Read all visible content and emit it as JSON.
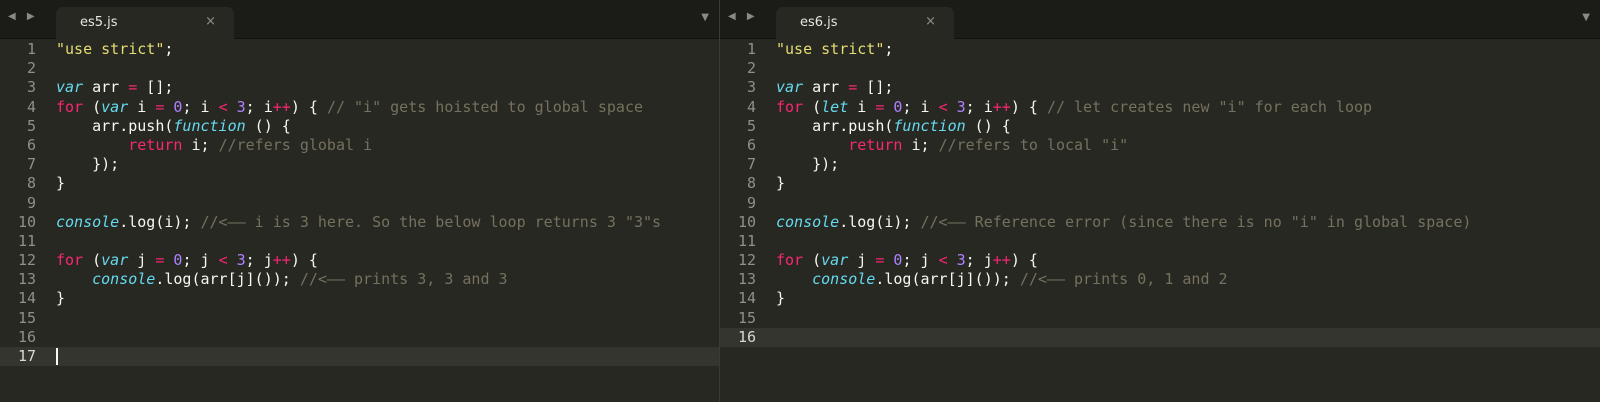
{
  "left": {
    "tab": {
      "label": "es5.js",
      "close": "×"
    },
    "nav": "◀ ▶",
    "dropdown": "▼",
    "lines": [
      {
        "n": "1",
        "tokens": [
          [
            "str",
            "\"use strict\""
          ],
          [
            "pl",
            ";"
          ]
        ]
      },
      {
        "n": "2",
        "tokens": []
      },
      {
        "n": "3",
        "tokens": [
          [
            "st",
            "var"
          ],
          [
            "pl",
            " arr "
          ],
          [
            "op",
            "="
          ],
          [
            "pl",
            " [];"
          ]
        ]
      },
      {
        "n": "4",
        "tokens": [
          [
            "kw",
            "for"
          ],
          [
            "pl",
            " ("
          ],
          [
            "st",
            "var"
          ],
          [
            "pl",
            " i "
          ],
          [
            "op",
            "="
          ],
          [
            "pl",
            " "
          ],
          [
            "num",
            "0"
          ],
          [
            "pl",
            "; i "
          ],
          [
            "op",
            "<"
          ],
          [
            "pl",
            " "
          ],
          [
            "num",
            "3"
          ],
          [
            "pl",
            "; i"
          ],
          [
            "op",
            "++"
          ],
          [
            "pl",
            ") { "
          ],
          [
            "cm",
            "// \"i\" gets hoisted to global space"
          ]
        ]
      },
      {
        "n": "5",
        "tokens": [
          [
            "pl",
            "    arr"
          ],
          [
            "pl",
            "."
          ],
          [
            "fn",
            "push"
          ],
          [
            "pl",
            "("
          ],
          [
            "st",
            "function"
          ],
          [
            "pl",
            " () {"
          ]
        ]
      },
      {
        "n": "6",
        "tokens": [
          [
            "pl",
            "        "
          ],
          [
            "kw",
            "return"
          ],
          [
            "pl",
            " i; "
          ],
          [
            "cm",
            "//refers global i"
          ]
        ]
      },
      {
        "n": "7",
        "tokens": [
          [
            "pl",
            "    });"
          ]
        ]
      },
      {
        "n": "8",
        "tokens": [
          [
            "pl",
            "}"
          ]
        ]
      },
      {
        "n": "9",
        "tokens": []
      },
      {
        "n": "10",
        "tokens": [
          [
            "st",
            "console"
          ],
          [
            "pl",
            "."
          ],
          [
            "fn",
            "log"
          ],
          [
            "pl",
            "(i); "
          ],
          [
            "cm",
            "//<—— i is 3 here. So the below loop returns 3 \"3\"s"
          ]
        ]
      },
      {
        "n": "11",
        "tokens": []
      },
      {
        "n": "12",
        "tokens": [
          [
            "kw",
            "for"
          ],
          [
            "pl",
            " ("
          ],
          [
            "st",
            "var"
          ],
          [
            "pl",
            " j "
          ],
          [
            "op",
            "="
          ],
          [
            "pl",
            " "
          ],
          [
            "num",
            "0"
          ],
          [
            "pl",
            "; j "
          ],
          [
            "op",
            "<"
          ],
          [
            "pl",
            " "
          ],
          [
            "num",
            "3"
          ],
          [
            "pl",
            "; j"
          ],
          [
            "op",
            "++"
          ],
          [
            "pl",
            ") {"
          ]
        ]
      },
      {
        "n": "13",
        "tokens": [
          [
            "pl",
            "    "
          ],
          [
            "st",
            "console"
          ],
          [
            "pl",
            "."
          ],
          [
            "fn",
            "log"
          ],
          [
            "pl",
            "(arr[j]()); "
          ],
          [
            "cm",
            "//<—— prints 3, 3 and 3"
          ]
        ]
      },
      {
        "n": "14",
        "tokens": [
          [
            "pl",
            "}"
          ]
        ]
      },
      {
        "n": "15",
        "tokens": []
      },
      {
        "n": "16",
        "tokens": []
      },
      {
        "n": "17",
        "tokens": [],
        "current": true
      }
    ]
  },
  "right": {
    "tab": {
      "label": "es6.js",
      "close": "×"
    },
    "nav": "◀ ▶",
    "dropdown": "▼",
    "lines": [
      {
        "n": "1",
        "tokens": [
          [
            "str",
            "\"use strict\""
          ],
          [
            "pl",
            ";"
          ]
        ]
      },
      {
        "n": "2",
        "tokens": []
      },
      {
        "n": "3",
        "tokens": [
          [
            "st",
            "var"
          ],
          [
            "pl",
            " arr "
          ],
          [
            "op",
            "="
          ],
          [
            "pl",
            " [];"
          ]
        ]
      },
      {
        "n": "4",
        "tokens": [
          [
            "kw",
            "for"
          ],
          [
            "pl",
            " ("
          ],
          [
            "st",
            "let"
          ],
          [
            "pl",
            " i "
          ],
          [
            "op",
            "="
          ],
          [
            "pl",
            " "
          ],
          [
            "num",
            "0"
          ],
          [
            "pl",
            "; i "
          ],
          [
            "op",
            "<"
          ],
          [
            "pl",
            " "
          ],
          [
            "num",
            "3"
          ],
          [
            "pl",
            "; i"
          ],
          [
            "op",
            "++"
          ],
          [
            "pl",
            ") { "
          ],
          [
            "cm",
            "// let creates new \"i\" for each loop"
          ]
        ]
      },
      {
        "n": "5",
        "tokens": [
          [
            "pl",
            "    arr"
          ],
          [
            "pl",
            "."
          ],
          [
            "fn",
            "push"
          ],
          [
            "pl",
            "("
          ],
          [
            "st",
            "function"
          ],
          [
            "pl",
            " () {"
          ]
        ]
      },
      {
        "n": "6",
        "tokens": [
          [
            "pl",
            "        "
          ],
          [
            "kw",
            "return"
          ],
          [
            "pl",
            " i; "
          ],
          [
            "cm",
            "//refers to local \"i\""
          ]
        ]
      },
      {
        "n": "7",
        "tokens": [
          [
            "pl",
            "    });"
          ]
        ]
      },
      {
        "n": "8",
        "tokens": [
          [
            "pl",
            "}"
          ]
        ]
      },
      {
        "n": "9",
        "tokens": []
      },
      {
        "n": "10",
        "tokens": [
          [
            "st",
            "console"
          ],
          [
            "pl",
            "."
          ],
          [
            "fn",
            "log"
          ],
          [
            "pl",
            "(i); "
          ],
          [
            "cm",
            "//<—— Reference error (since there is no \"i\" in global space)"
          ]
        ]
      },
      {
        "n": "11",
        "tokens": []
      },
      {
        "n": "12",
        "tokens": [
          [
            "kw",
            "for"
          ],
          [
            "pl",
            " ("
          ],
          [
            "st",
            "var"
          ],
          [
            "pl",
            " j "
          ],
          [
            "op",
            "="
          ],
          [
            "pl",
            " "
          ],
          [
            "num",
            "0"
          ],
          [
            "pl",
            "; j "
          ],
          [
            "op",
            "<"
          ],
          [
            "pl",
            " "
          ],
          [
            "num",
            "3"
          ],
          [
            "pl",
            "; j"
          ],
          [
            "op",
            "++"
          ],
          [
            "pl",
            ") {"
          ]
        ]
      },
      {
        "n": "13",
        "tokens": [
          [
            "pl",
            "    "
          ],
          [
            "st",
            "console"
          ],
          [
            "pl",
            "."
          ],
          [
            "fn",
            "log"
          ],
          [
            "pl",
            "(arr[j]()); "
          ],
          [
            "cm",
            "//<—— prints 0, 1 and 2"
          ]
        ]
      },
      {
        "n": "14",
        "tokens": [
          [
            "pl",
            "}"
          ]
        ]
      },
      {
        "n": "15",
        "tokens": []
      },
      {
        "n": "16",
        "tokens": [],
        "current": true
      }
    ]
  },
  "colors": {
    "background": "#272822",
    "keyword": "#f92672",
    "storage": "#66d9ef",
    "string": "#e6db74",
    "number": "#ae81ff",
    "comment": "#75715e"
  }
}
